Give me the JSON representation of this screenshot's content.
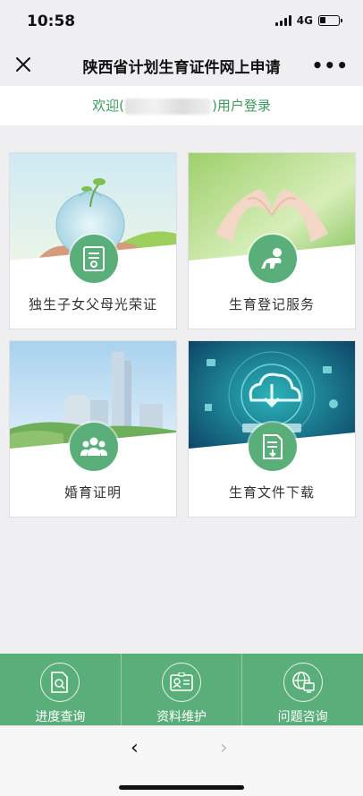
{
  "status": {
    "time": "10:58",
    "network": "4G"
  },
  "nav": {
    "title": "陕西省计划生育证件网上申请",
    "close_icon": "close-icon",
    "more_label": "•••"
  },
  "welcome": {
    "prefix": "欢迎(",
    "suffix": ")用户登录"
  },
  "cards": [
    {
      "label": "独生子女父母光荣证",
      "icon": "certificate-icon"
    },
    {
      "label": "生育登记服务",
      "icon": "baby-icon"
    },
    {
      "label": "婚育证明",
      "icon": "people-icon"
    },
    {
      "label": "生育文件下载",
      "icon": "download-document-icon"
    }
  ],
  "tabbar": [
    {
      "label": "进度查询",
      "icon": "progress-search-icon"
    },
    {
      "label": "资料维护",
      "icon": "id-card-icon"
    },
    {
      "label": "问题咨询",
      "icon": "globe-computer-icon"
    }
  ],
  "browser": {
    "back": "‹",
    "forward": "›"
  },
  "colors": {
    "accent": "#5aae79",
    "welcome_text": "#3d9a5a"
  }
}
